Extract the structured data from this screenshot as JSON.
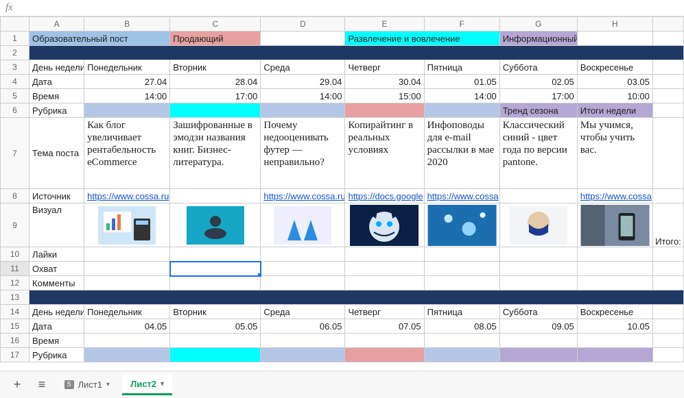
{
  "fx_label": "fx",
  "column_headers": [
    "A",
    "B",
    "C",
    "D",
    "E",
    "F",
    "G",
    "H"
  ],
  "row_headers": [
    "1",
    "2",
    "3",
    "4",
    "5",
    "6",
    "7",
    "8",
    "9",
    "10",
    "11",
    "12",
    "13",
    "14",
    "15",
    "16",
    "17"
  ],
  "legend": {
    "edu": "Образовательный пост",
    "sell": "Продающий",
    "ent": "Развлечение и вовлечение",
    "info": "Информационный"
  },
  "labels": {
    "day_of_week": "День недели",
    "date": "Дата",
    "time": "Время",
    "rubric": "Рубрика",
    "topic": "Тема поста",
    "source": "Источник",
    "visual": "Визуал",
    "likes": "Лайки",
    "reach": "Охват",
    "comments": "Комменты",
    "total": "Итого:"
  },
  "week1": {
    "days": [
      "Понедельник",
      "Вторник",
      "Среда",
      "Четверг",
      "Пятница",
      "Суббота",
      "Воскресенье"
    ],
    "dates": [
      "27.04",
      "28.04",
      "29.04",
      "30.04",
      "01.05",
      "02.05",
      "03.05"
    ],
    "times": [
      "14:00",
      "17:00",
      "14:00",
      "15:00",
      "14:00",
      "17:00",
      "10:00"
    ],
    "rubrics": [
      "",
      "",
      "",
      "",
      "",
      "Тренд сезона",
      "Итоги недели"
    ],
    "topics": [
      "Как блог увеличивает рентабельность eCommerce",
      "Зашифрованные в эмодзи названия книг. Бизнес-литература.",
      "Почему недооценивать футер — неправильно?",
      "Копирайтинг в реальных условиях",
      "Инфоповоды для e-mail рассылки в мае 2020",
      "Классический синий - цвет года по версии pantone.",
      "Мы учимся, чтобы учить вас."
    ],
    "sources": [
      "https://www.cossa.ru",
      "",
      "https://www.cossa.ru",
      "https://docs.google",
      "https://www.cossa",
      "",
      "https://www.cossa"
    ]
  },
  "week2": {
    "days": [
      "Понедельник",
      "Вторник",
      "Среда",
      "Четверг",
      "Пятница",
      "Суббота",
      "Воскресенье"
    ],
    "dates": [
      "04.05",
      "05.05",
      "06.05",
      "07.05",
      "08.05",
      "09.05",
      "10.05"
    ]
  },
  "sheets": {
    "sheet1": "Лист1",
    "sheet1_badge": "5",
    "sheet2": "Лист2"
  },
  "icons": {
    "add": "+",
    "menu": "≡",
    "dropdown": "▾"
  }
}
